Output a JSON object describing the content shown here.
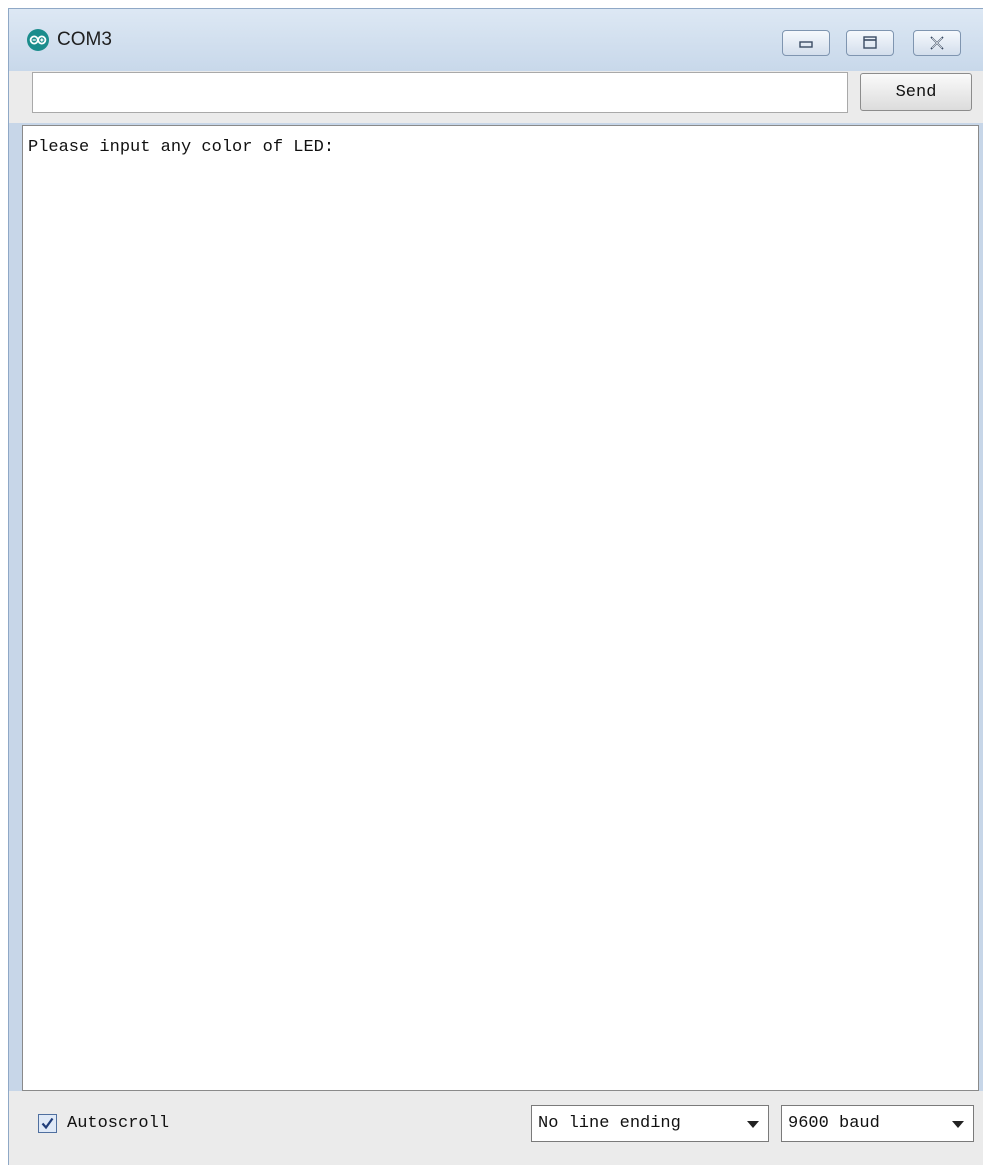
{
  "window": {
    "title": "COM3",
    "app_icon": "arduino-infinity-icon",
    "controls": [
      "minimize-icon",
      "restore-icon",
      "close-icon"
    ]
  },
  "send_bar": {
    "input_value": "",
    "send_label": "Send"
  },
  "console": {
    "lines": [
      "Please input any color of LED:"
    ]
  },
  "footer": {
    "autoscroll_label": "Autoscroll",
    "autoscroll_checked": true,
    "line_ending": "No line ending",
    "baud_rate": "9600 baud"
  },
  "colors": {
    "titlebar": "#c8d8ea",
    "accent": "#1b8c8c"
  }
}
